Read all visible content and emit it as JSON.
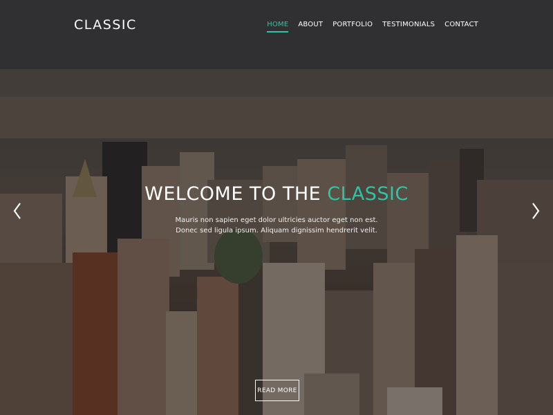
{
  "header": {
    "logo": "CLASSIC",
    "nav": [
      {
        "label": "HOME",
        "active": true
      },
      {
        "label": "ABOUT",
        "active": false
      },
      {
        "label": "PORTFOLIO",
        "active": false
      },
      {
        "label": "TESTIMONIALS",
        "active": false
      },
      {
        "label": "CONTACT",
        "active": false
      }
    ]
  },
  "hero": {
    "title_main": "WELCOME TO THE ",
    "title_accent": "CLASSIC",
    "text_line1": "Mauris non sapien eget dolor ultricies auctor eget non est.",
    "text_line2": "Donec sed ligula ipsum. Aliquam dignissim hendrerit velit.",
    "button_label": "READ MORE",
    "prev_icon": "chevron-left-icon",
    "next_icon": "chevron-right-icon"
  },
  "colors": {
    "accent": "#2ec4a6",
    "text": "#ffffff"
  }
}
